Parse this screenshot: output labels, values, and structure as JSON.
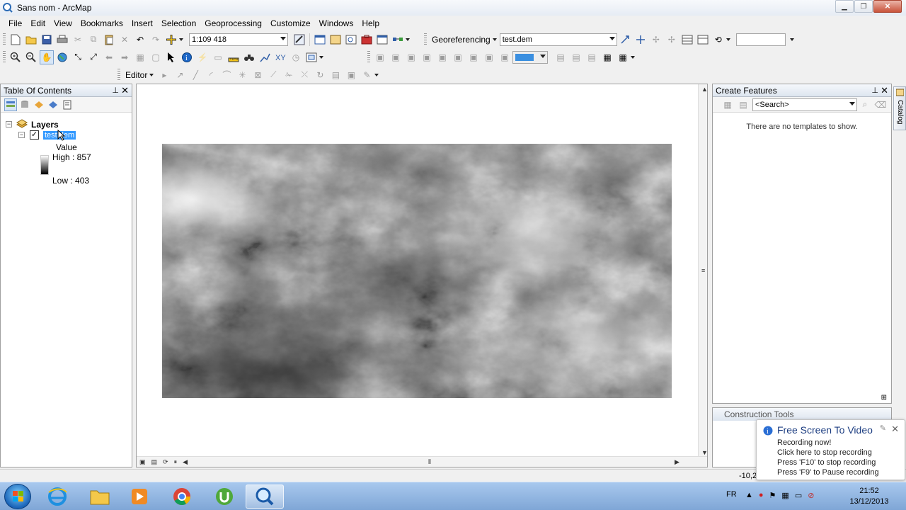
{
  "window": {
    "title": "Sans nom - ArcMap"
  },
  "menu": [
    "File",
    "Edit",
    "View",
    "Bookmarks",
    "Insert",
    "Selection",
    "Geoprocessing",
    "Customize",
    "Windows",
    "Help"
  ],
  "toolbar": {
    "scale_value": "1:109 418",
    "georeferencing_label": "Georeferencing",
    "georef_layer_value": "test.dem",
    "editor_label": "Editor"
  },
  "toc": {
    "title": "Table Of Contents",
    "root_label": "Layers",
    "layer_name": "test.dem",
    "legend_field": "Value",
    "high_label": "High : 857",
    "low_label": "Low : 403"
  },
  "create_features": {
    "title": "Create Features",
    "search_placeholder": "<Search>",
    "empty_message": "There are no templates to show."
  },
  "catalog_tab": "Catalog",
  "construction_tools": {
    "title": "Construction Tools"
  },
  "popup": {
    "title": "Free Screen To Video",
    "lines": [
      "Recording now!",
      "Click here to stop recording",
      "Press 'F10' to stop recording",
      "Press 'F9' to Pause recording"
    ]
  },
  "status": {
    "coordinates": "-10,2"
  },
  "taskbar": {
    "language": "FR",
    "time": "21:52",
    "date": "13/12/2013"
  },
  "colors": {
    "selection": "#3399ff",
    "taskbar": "#8fb3e0",
    "accent_title": "#1b3c80"
  }
}
